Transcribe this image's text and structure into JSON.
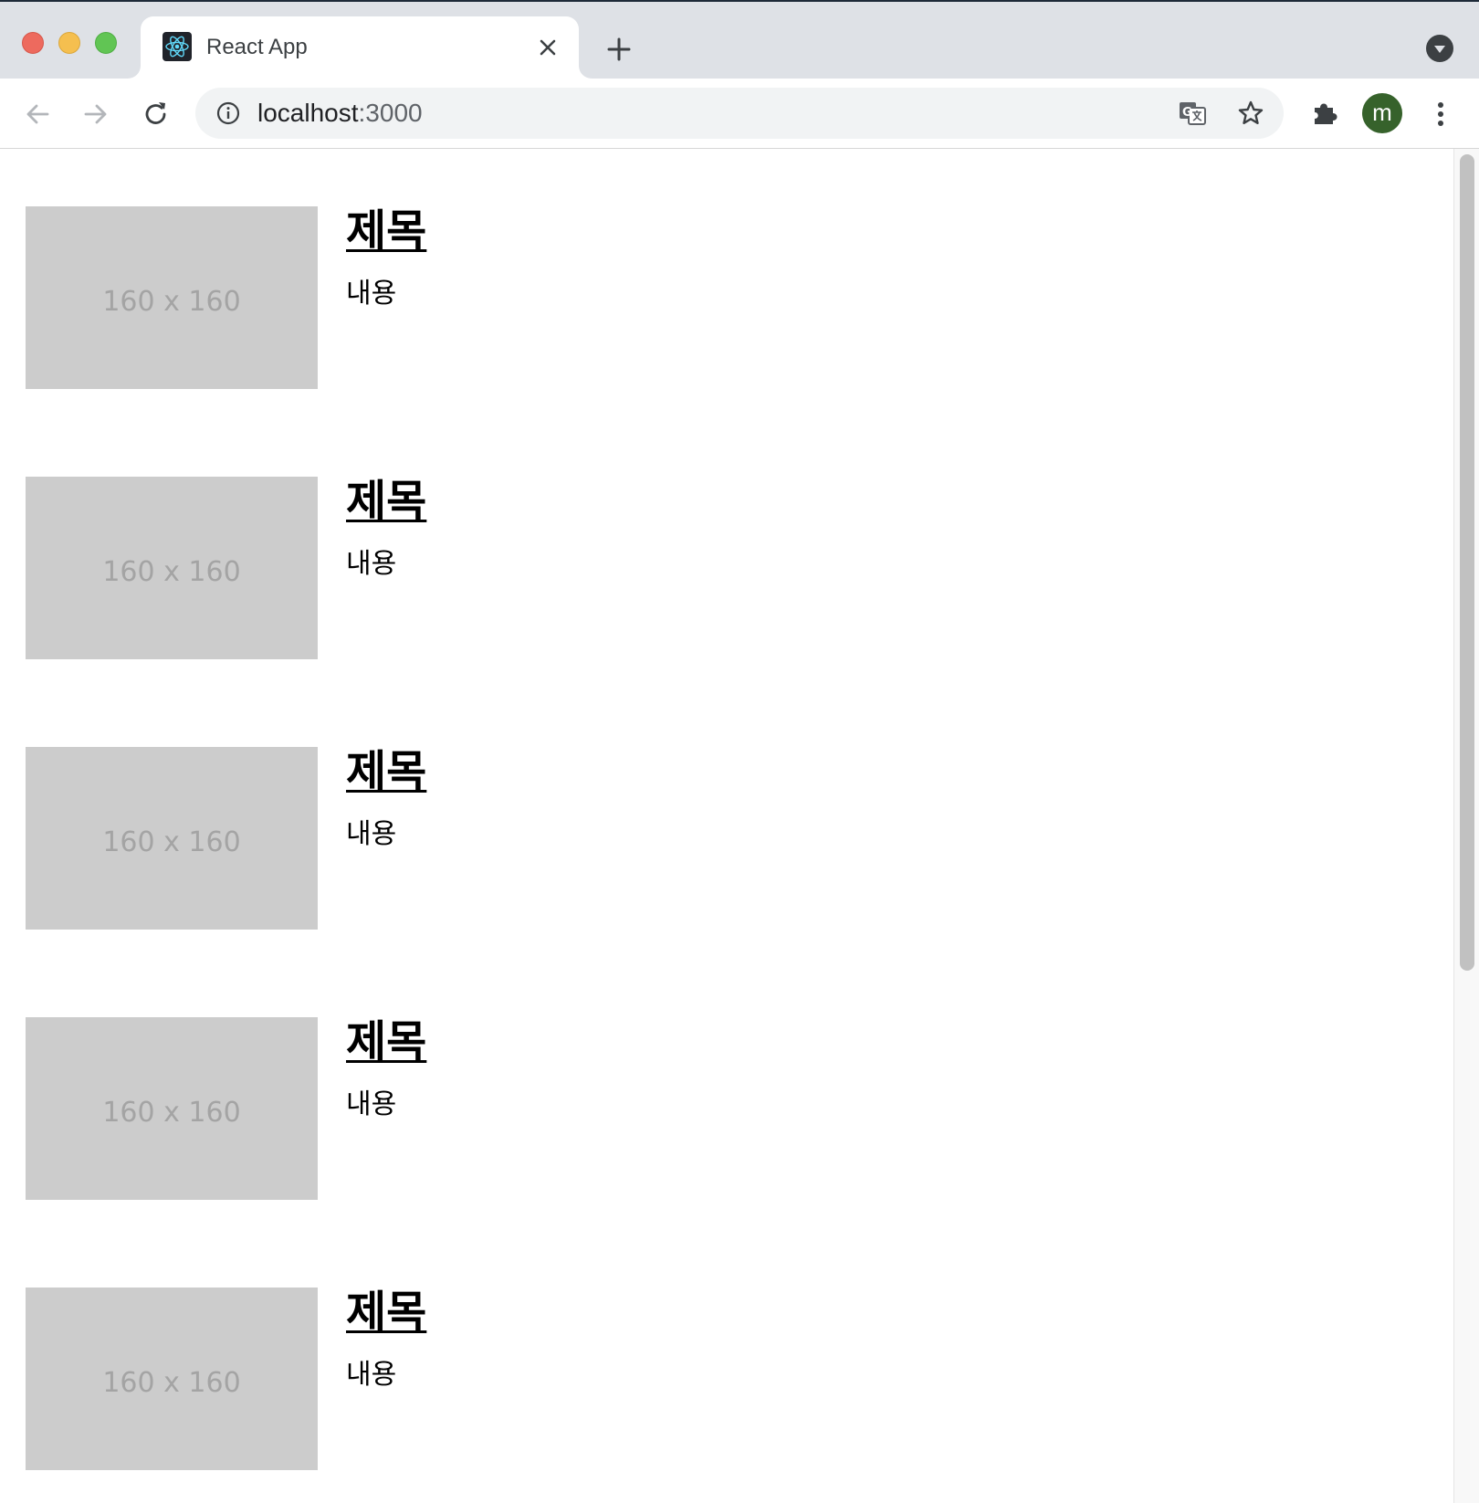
{
  "browser": {
    "tab": {
      "title": "React App",
      "favicon": "react-logo-icon"
    },
    "omnibox": {
      "host": "localhost",
      "port": ":3000"
    },
    "profile_initial": "m",
    "colors": {
      "tabstrip": "#dee1e6",
      "avatar": "#36622b",
      "react_accent": "#61dafb"
    }
  },
  "page": {
    "cards": [
      {
        "thumbnail_text": "160 x 160",
        "title": "제목",
        "body": "내용"
      },
      {
        "thumbnail_text": "160 x 160",
        "title": "제목",
        "body": "내용"
      },
      {
        "thumbnail_text": "160 x 160",
        "title": "제목",
        "body": "내용"
      },
      {
        "thumbnail_text": "160 x 160",
        "title": "제목",
        "body": "내용"
      },
      {
        "thumbnail_text": "160 x 160",
        "title": "제목",
        "body": "내용"
      }
    ]
  }
}
